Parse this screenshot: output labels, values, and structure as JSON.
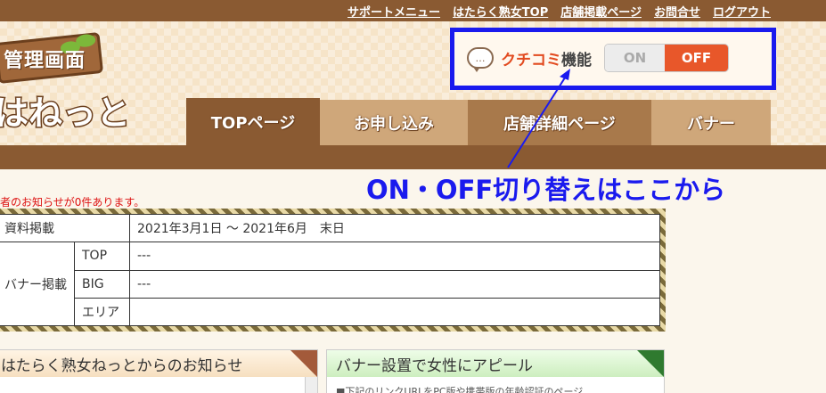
{
  "top_links": [
    "サポートメニュー",
    "はたらく熟女TOP",
    "店舗掲載ページ",
    "お問合せ",
    "ログアウト"
  ],
  "logo": {
    "title": "管理画面",
    "brand": "はねっと"
  },
  "kuchikomi": {
    "bubble_icon": "…",
    "label_red": "クチコミ",
    "label_dark": "機能",
    "on": "ON",
    "off": "OFF",
    "state": "OFF",
    "highlight_color": "#1a1aee"
  },
  "nav": [
    "TOPページ",
    "お申し込み",
    "店舗詳細ページ",
    "バナー"
  ],
  "annotation": "ON・OFF切り替えはここから",
  "notice_count": "者のお知らせが0件あります。",
  "info_table": {
    "row1_label": "資料掲載",
    "row1_value": "2021年3月1日 〜 2021年6月　末日",
    "banner_label": "バナー掲載",
    "rows": [
      {
        "type": "TOP",
        "value": "---"
      },
      {
        "type": "BIG",
        "value": "---"
      },
      {
        "type": "エリア",
        "value": ""
      }
    ]
  },
  "panels": {
    "left_title": "はたらく熟女ねっとからのお知らせ",
    "right_title": "バナー設置で女性にアピール",
    "right_body": "■下記のリンクURLをPC版や携帯版の年齢認証のページ"
  }
}
